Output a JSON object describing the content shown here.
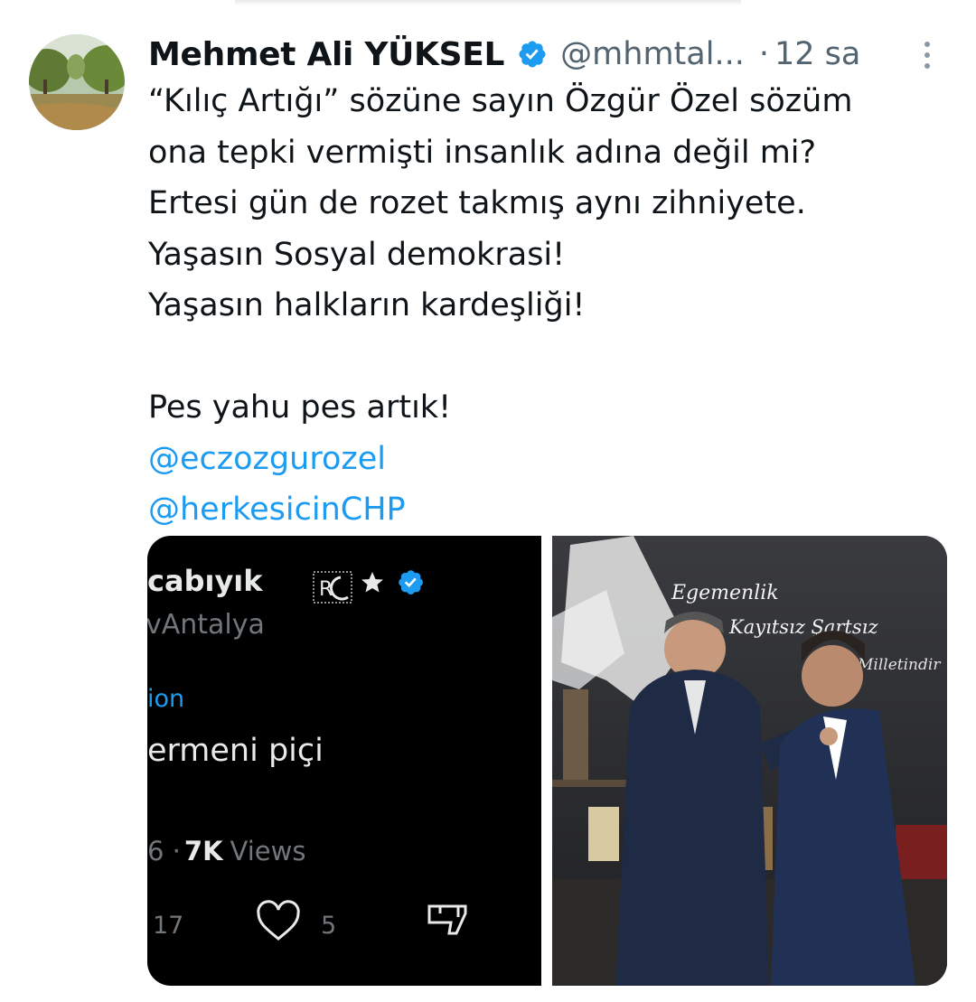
{
  "tweet": {
    "display_name": "Mehmet Ali YÜKSEL",
    "handle": "@mhmtal...",
    "separator": "·",
    "time": "12 sa",
    "lines": [
      "“Kılıç Artığı” sözüne sayın Özgür Özel sözüm",
      "ona tepki vermişti insanlık adına değil mi?",
      "Ertesi gün de rozet takmış aynı zihniyete.",
      "Yaşasın Sosyal demokrasi!",
      "Yaşasın halkların kardeşliği!"
    ],
    "closing_line": "Pes yahu pes artık!",
    "mentions": [
      "@eczozgurozel",
      "@herkesicinCHP"
    ]
  },
  "embedded_screenshot": {
    "name": "cabıyık",
    "badge": "R",
    "handle": "vAntalya",
    "context": "ion",
    "text": "ermeni piçi",
    "meta_prefix": "6 ·",
    "views_count": "7K",
    "views_label": "Views",
    "reply_count": "17",
    "like_count": "5"
  },
  "photo": {
    "wall_line_1": "Egemenlik",
    "wall_line_2": "Kayıtsız Şartsız",
    "wall_line_3": "Milletindir"
  },
  "colors": {
    "text": "#0f1419",
    "secondary": "#536471",
    "link": "#1d9bf0",
    "verified": "#1d9bf0"
  },
  "icons": [
    "verified-badge-icon",
    "more-options-icon",
    "heart-icon",
    "dislike-icon"
  ]
}
